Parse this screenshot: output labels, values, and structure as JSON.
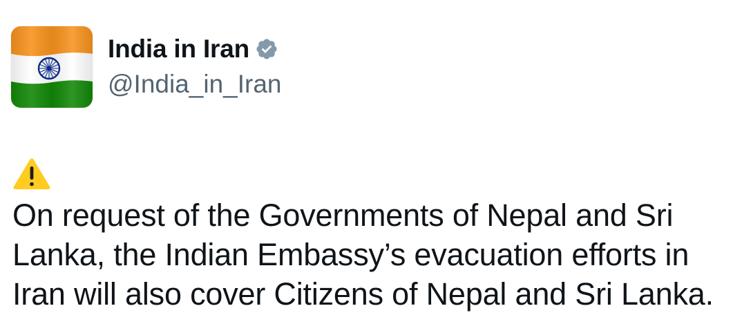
{
  "author": {
    "name": "India in Iran",
    "handle": "@India_in_Iran",
    "verified_icon": "verified-badge-icon",
    "verified_color": "#829aab",
    "avatar": "indian-flag"
  },
  "post": {
    "warning_icon": "warning-icon",
    "text": "On request of the Governments of Nepal and Sri\nLanka, the Indian Embassy’s evacuation efforts in\nIran will also cover Citizens of Nepal and Sri Lanka."
  },
  "colors": {
    "text_primary": "#0f1419",
    "text_secondary": "#536471",
    "flag_saffron": "#f7931e",
    "flag_white": "#ffffff",
    "flag_green": "#138808",
    "chakra_navy": "#0a2a8a",
    "warning_yellow": "#ffcc1f"
  }
}
